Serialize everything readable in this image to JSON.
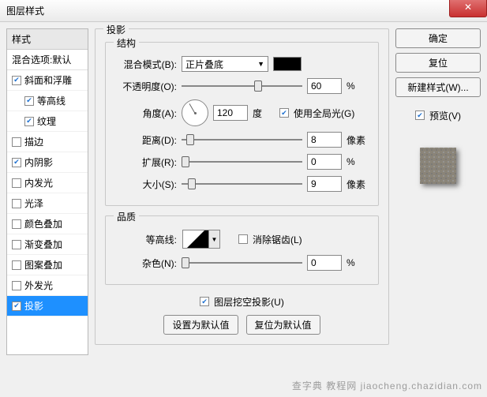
{
  "window": {
    "title": "图层样式",
    "close": "✕"
  },
  "sidebar": {
    "header": "样式",
    "blend": "混合选项:默认",
    "items": [
      {
        "label": "斜面和浮雕",
        "checked": true,
        "indent": false
      },
      {
        "label": "等高线",
        "checked": true,
        "indent": true
      },
      {
        "label": "纹理",
        "checked": true,
        "indent": true
      },
      {
        "label": "描边",
        "checked": false,
        "indent": false
      },
      {
        "label": "内阴影",
        "checked": true,
        "indent": false
      },
      {
        "label": "内发光",
        "checked": false,
        "indent": false
      },
      {
        "label": "光泽",
        "checked": false,
        "indent": false
      },
      {
        "label": "颜色叠加",
        "checked": false,
        "indent": false
      },
      {
        "label": "渐变叠加",
        "checked": false,
        "indent": false
      },
      {
        "label": "图案叠加",
        "checked": false,
        "indent": false
      },
      {
        "label": "外发光",
        "checked": false,
        "indent": false
      },
      {
        "label": "投影",
        "checked": true,
        "indent": false,
        "selected": true
      }
    ]
  },
  "main": {
    "heading": "投影",
    "structure": {
      "legend": "结构",
      "blend_mode_label": "混合模式(B):",
      "blend_mode_value": "正片叠底",
      "color": "#000000",
      "opacity_label": "不透明度(O):",
      "opacity_value": "60",
      "opacity_unit": "%",
      "angle_label": "角度(A):",
      "angle_value": "120",
      "angle_unit": "度",
      "global_light_label": "使用全局光(G)",
      "global_light_checked": true,
      "distance_label": "距离(D):",
      "distance_value": "8",
      "distance_unit": "像素",
      "spread_label": "扩展(R):",
      "spread_value": "0",
      "spread_unit": "%",
      "size_label": "大小(S):",
      "size_value": "9",
      "size_unit": "像素"
    },
    "quality": {
      "legend": "品质",
      "contour_label": "等高线:",
      "antialias_label": "消除锯齿(L)",
      "antialias_checked": false,
      "noise_label": "杂色(N):",
      "noise_value": "0",
      "noise_unit": "%"
    },
    "knockout_label": "图层挖空投影(U)",
    "knockout_checked": true,
    "defaults_btn": "设置为默认值",
    "reset_btn": "复位为默认值"
  },
  "right": {
    "ok": "确定",
    "cancel": "复位",
    "new_style": "新建样式(W)...",
    "preview_label": "预览(V)",
    "preview_checked": true
  },
  "watermark": "查字典 教程网 jiaocheng.chazidian.com"
}
